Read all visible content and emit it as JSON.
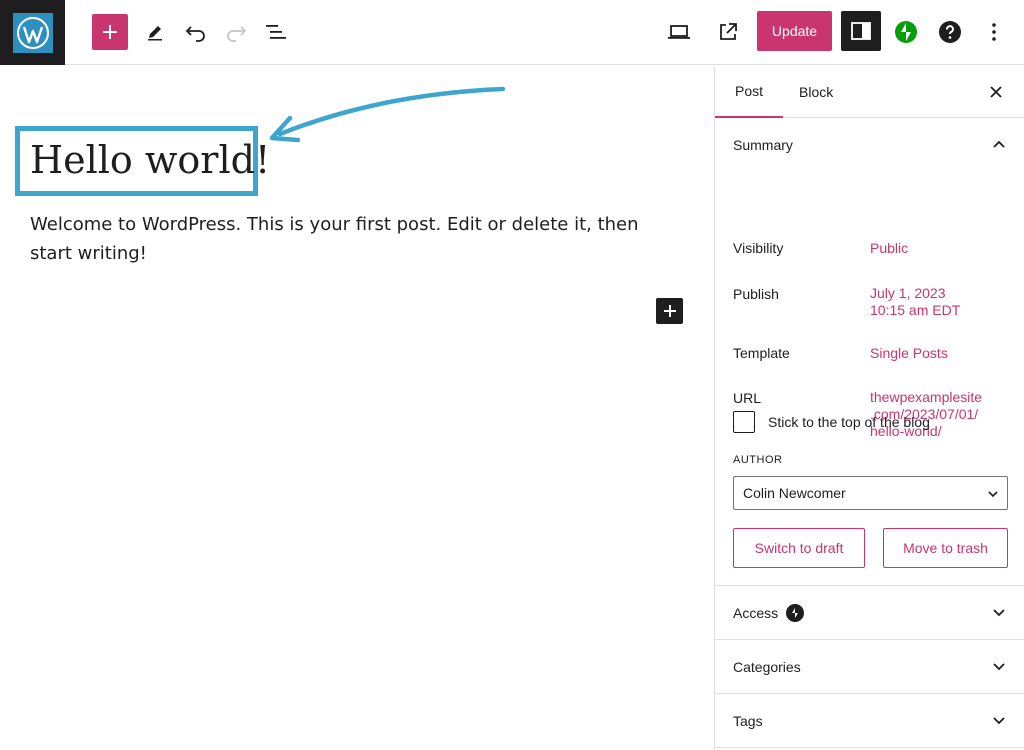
{
  "toolbar": {
    "update_label": "Update"
  },
  "editor": {
    "title": "Hello world!",
    "body": "Welcome to WordPress. This is your first post. Edit or delete it, then start writing!"
  },
  "sidebar": {
    "tabs": [
      "Post",
      "Block"
    ],
    "summary": {
      "heading": "Summary",
      "visibility_label": "Visibility",
      "visibility_value": "Public",
      "publish_label": "Publish",
      "publish_date": "July 1, 2023",
      "publish_time": "10:15 am EDT",
      "template_label": "Template",
      "template_value": "Single Posts",
      "url_label": "URL",
      "url_line1": "thewpexamplesite",
      "url_line2": ".com/2023/07/01/",
      "url_line3": "hello-world/",
      "sticky_label": "Stick to the top of the blog",
      "author_label": "AUTHOR",
      "author_value": "Colin Newcomer",
      "draft_button": "Switch to draft",
      "trash_button": "Move to trash"
    },
    "panels": [
      "Access",
      "Categories",
      "Tags"
    ]
  },
  "colors": {
    "accent": "#c9356e",
    "highlight_box": "#3ea6cd",
    "jetpack": "#069e08"
  },
  "icons": {
    "logo": "wordpress-logo",
    "inserter": "plus-icon",
    "tools": "pencil-icon",
    "undo": "undo-icon",
    "redo": "redo-icon",
    "list_view": "list-view-icon",
    "preview": "laptop-icon",
    "view_post": "external-link-icon",
    "settings": "sidebar-toggle-icon",
    "jetpack": "jetpack-icon",
    "help": "help-icon",
    "options": "more-vertical-icon"
  }
}
